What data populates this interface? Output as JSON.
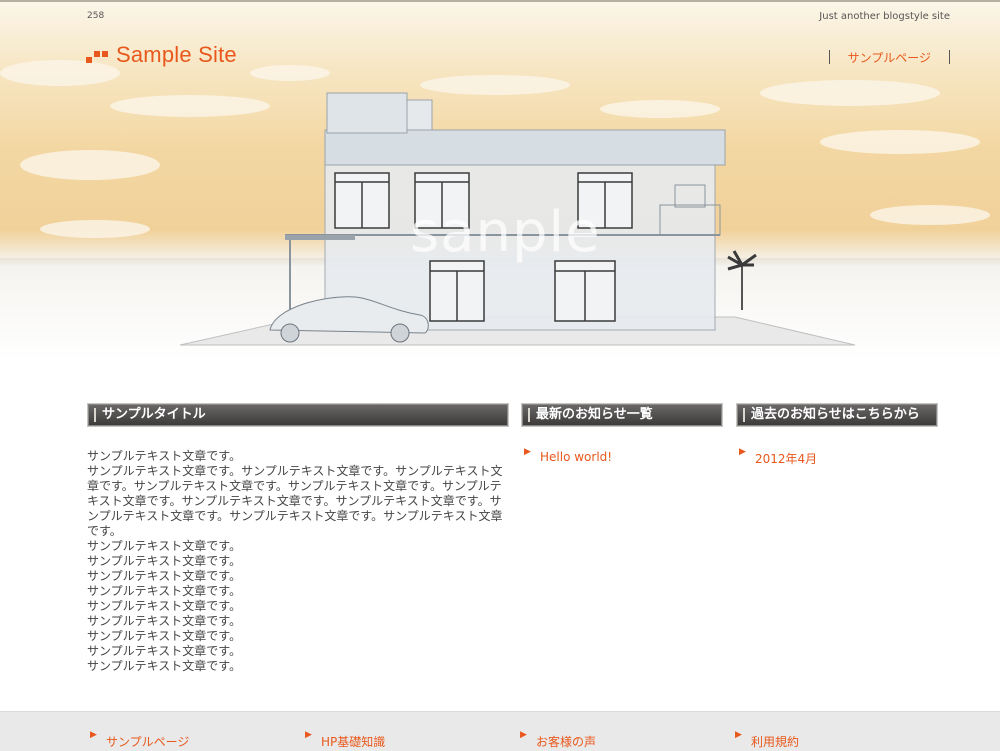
{
  "header": {
    "post_number": "258",
    "tagline": "Just another blogstyle site",
    "site_title": "Sample Site",
    "nav": [
      {
        "label": "サンプルページ"
      }
    ]
  },
  "hero": {
    "watermark": "sanple"
  },
  "main": {
    "title": "サンプルタイトル",
    "paragraphs": [
      "サンプルテキスト文章です。",
      "サンプルテキスト文章です。サンプルテキスト文章です。サンプルテキスト文章です。サンプルテキスト文章です。サンプルテキスト文章です。サンプルテキスト文章です。サンプルテキスト文章です。サンプルテキスト文章です。サンプルテキスト文章です。サンプルテキスト文章です。サンプルテキスト文章です。",
      "サンプルテキスト文章です。",
      "サンプルテキスト文章です。",
      "サンプルテキスト文章です。",
      "サンプルテキスト文章です。",
      "サンプルテキスト文章です。",
      "サンプルテキスト文章です。",
      "サンプルテキスト文章です。",
      "サンプルテキスト文章です。",
      "サンプルテキスト文章です。"
    ]
  },
  "news": {
    "title": "最新のお知らせ一覧",
    "items": [
      {
        "label": "Hello world!"
      }
    ]
  },
  "archive": {
    "title": "過去のお知らせはこちらから",
    "items": [
      {
        "label": "2012年4月"
      }
    ]
  },
  "footer": {
    "links": [
      {
        "label": "サンプルページ"
      },
      {
        "label": "HP基礎知識"
      },
      {
        "label": "お客様の声"
      },
      {
        "label": "利用規約"
      }
    ]
  },
  "colors": {
    "accent": "#e8581c",
    "bar": "#4a4847",
    "footer_bg": "#eae9e9"
  }
}
